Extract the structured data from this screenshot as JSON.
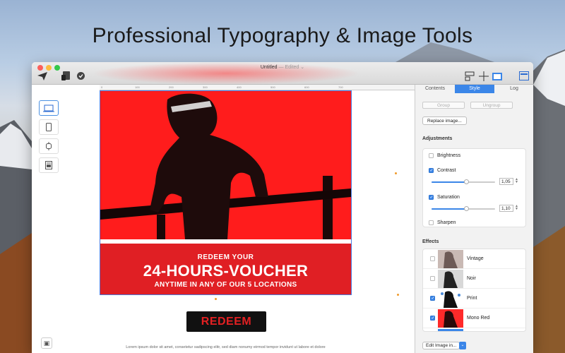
{
  "hero": {
    "title": "Professional Typography & Image Tools"
  },
  "window": {
    "title": "Untitled",
    "edited": "— Edited ⌄"
  },
  "ruler": {
    "ticks": [
      "0",
      "100",
      "200",
      "300",
      "400",
      "500",
      "600",
      "700"
    ]
  },
  "artboard": {
    "line1": "REDEEM YOUR",
    "line2": "24-HOURS-VOUCHER",
    "line3": "ANYTIME IN ANY OF OUR 5 LOCATIONS",
    "button": "REDEEM",
    "lorem": "Lorem ipsum dolor sit amet, consetetur sadipscing elitr, sed diam nonumy eirmod tempor invidunt ut labore et dolore"
  },
  "inspector": {
    "tabs": [
      "Contents",
      "Style",
      "Log"
    ],
    "active_tab": "Style",
    "group_label": "Group",
    "ungroup_label": "Ungroup",
    "replace_label": "Replace image...",
    "adjustments_title": "Adjustments",
    "brightness_label": "Brightness",
    "contrast_label": "Contrast",
    "contrast_value": "1,05",
    "contrast_level": 0.55,
    "saturation_label": "Saturation",
    "saturation_value": "1,10",
    "saturation_level": 0.55,
    "sharpen_label": "Sharpen",
    "effects_title": "Effects",
    "effects": [
      {
        "name": "Vintage",
        "checked": false
      },
      {
        "name": "Noir",
        "checked": false
      },
      {
        "name": "Print",
        "checked": true
      },
      {
        "name": "Mono Red",
        "checked": true
      }
    ],
    "edit_label": "Edit Image in...",
    "edit_arrow": "⌄"
  },
  "colors": {
    "accent": "#3b86e8",
    "poster_red": "#ff1c1c",
    "promo_red": "#e01f24"
  }
}
